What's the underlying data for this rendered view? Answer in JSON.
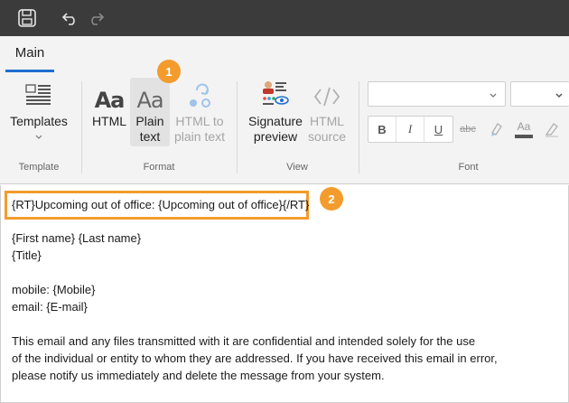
{
  "ribbon": {
    "tab_main": "Main",
    "template_group": {
      "label": "Template",
      "templates_button": "Templates"
    },
    "format_group": {
      "label": "Format",
      "html_button": "HTML",
      "plain_text_button_line1": "Plain",
      "plain_text_button_line2": "text",
      "html_to_plain_line1": "HTML to",
      "html_to_plain_line2": "plain text",
      "aa_glyph": "Aa"
    },
    "view_group": {
      "label": "View",
      "signature_preview_line1": "Signature",
      "signature_preview_line2": "preview",
      "html_source_line1": "HTML",
      "html_source_line2": "source"
    },
    "font_group": {
      "label": "Font",
      "bold": "B",
      "italic": "I",
      "underline": "U",
      "strikethrough": "abc",
      "font_color_glyph": "Aa"
    }
  },
  "callouts": {
    "one": "1",
    "two": "2"
  },
  "editor": {
    "lines": [
      "{RT}Upcoming out of office: {Upcoming out of office}{/RT}",
      "{First name} {Last name}",
      "{Title}",
      "mobile: {Mobile}",
      "email: {E-mail}",
      "This email and any files transmitted with it are confidential and intended solely for the use",
      "of the individual or entity to whom they are addressed. If you have received this email in error,",
      "please notify us immediately and delete the message from your system."
    ]
  },
  "colors": {
    "titlebar": "#3b3b3b",
    "accent": "#1e6fd0",
    "callout": "#f39c2d"
  }
}
